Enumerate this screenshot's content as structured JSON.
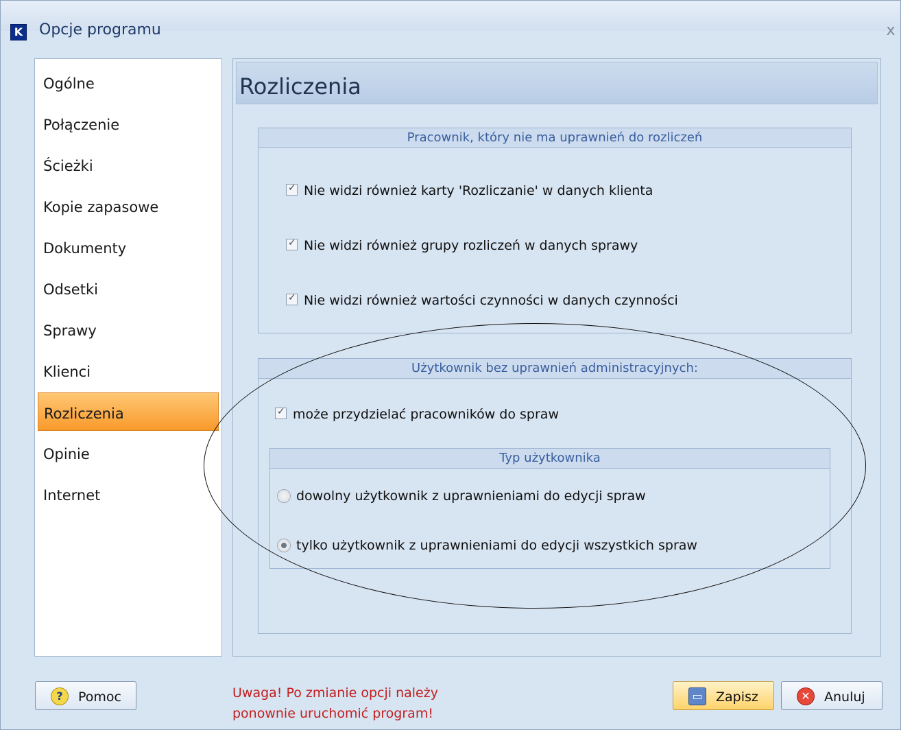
{
  "window": {
    "title": "Opcje programu",
    "app_icon_letter": "K",
    "close_glyph": "x"
  },
  "nav": {
    "items": [
      "Ogólne",
      "Połączenie",
      "Ścieżki",
      "Kopie zapasowe",
      "Dokumenty",
      "Odsetki",
      "Sprawy",
      "Klienci",
      "Rozliczenia",
      "Opinie",
      "Internet"
    ],
    "selected": "Rozliczenia"
  },
  "page": {
    "title": "Rozliczenia",
    "group1": {
      "title": "Pracownik, który nie ma uprawnień do rozliczeń",
      "options": [
        {
          "label": "Nie widzi również karty 'Rozliczanie' w danych klienta",
          "checked": true
        },
        {
          "label": "Nie widzi również grupy rozliczeń w danych sprawy",
          "checked": true
        },
        {
          "label": "Nie widzi również wartości czynności w danych czynności",
          "checked": true
        }
      ]
    },
    "group2": {
      "title": "Użytkownik bez uprawnień administracyjnych:",
      "assign_option": {
        "label": "może przydzielać pracowników do spraw",
        "checked": true
      },
      "user_type": {
        "title": "Typ użytkownika",
        "options": [
          {
            "label": "dowolny użytkownik z uprawnieniami do edycji spraw",
            "selected": false
          },
          {
            "label": "tylko użytkownik z uprawnieniami do edycji wszystkich spraw",
            "selected": true
          }
        ]
      }
    }
  },
  "footer": {
    "help_label": "Pomoc",
    "warning_line1": "Uwaga! Po zmianie opcji należy",
    "warning_line2": "ponownie uruchomić program!",
    "save_label": "Zapisz",
    "cancel_label": "Anuluj"
  },
  "colors": {
    "selected_nav": "#f99a2c",
    "warning_text": "#c21e1e",
    "group_title_text": "#3a5e9e"
  }
}
